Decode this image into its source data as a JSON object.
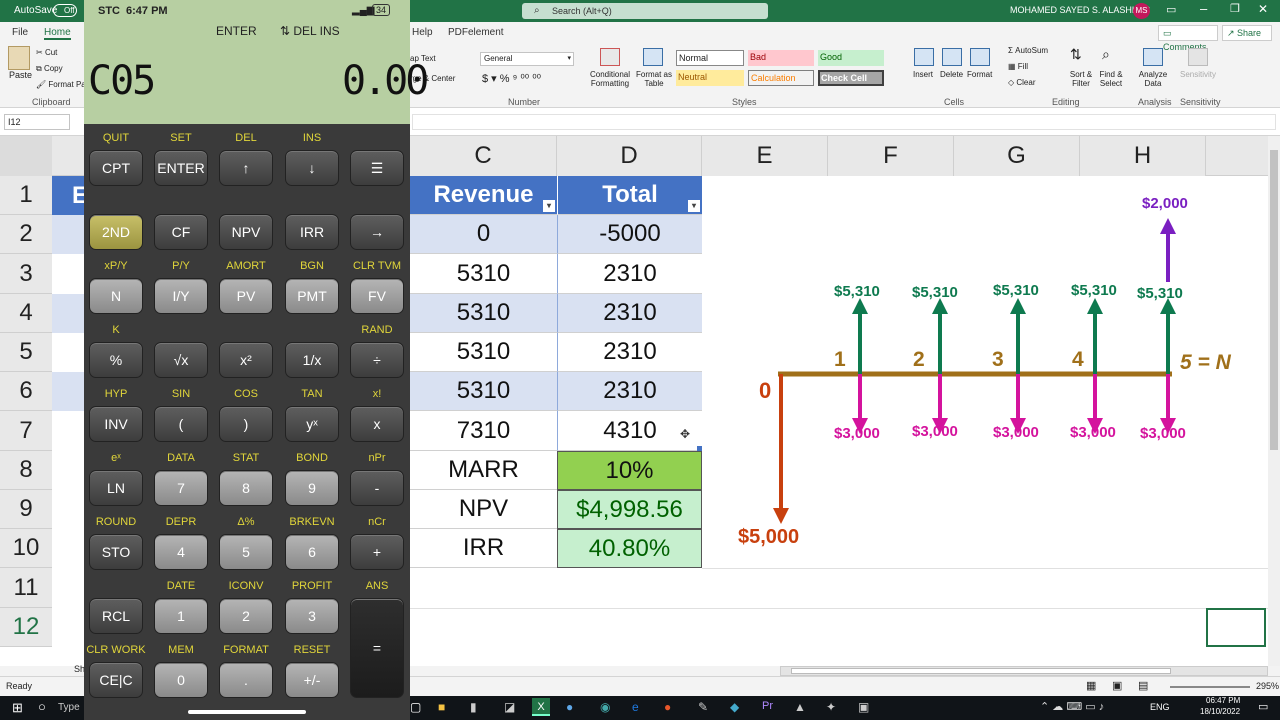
{
  "excel": {
    "titlebar": {
      "autosave": "AutoSave",
      "autosave_state": "Off",
      "search": "Search (Alt+Q)",
      "user": "MOHAMED SAYED S. ALASHHAB",
      "initials": "MS"
    },
    "ribbon_tabs": [
      "File",
      "Home",
      "Help",
      "PDFelement"
    ],
    "comments": "Comments",
    "share": "Share",
    "clipboard": {
      "paste": "Paste",
      "cut": "Cut",
      "copy": "Copy",
      "format_painter": "Format Pa",
      "group": "Clipboard"
    },
    "alignment": {
      "wrap_text": "ap Text",
      "merge": "rge & Center"
    },
    "number": {
      "format": "General",
      "group": "Number"
    },
    "styles": {
      "conditional": "Conditional Formatting",
      "format_table": "Format as Table",
      "normal": "Normal",
      "bad": "Bad",
      "good": "Good",
      "neutral": "Neutral",
      "calculation": "Calculation",
      "check_cell": "Check Cell",
      "group": "Styles"
    },
    "cells_group": {
      "insert": "Insert",
      "delete": "Delete",
      "format": "Format",
      "group": "Cells"
    },
    "editing": {
      "autosum": "AutoSum",
      "fill": "Fill",
      "clear": "Clear",
      "sort": "Sort & Filter",
      "find": "Find & Select",
      "group": "Editing"
    },
    "analysis": {
      "analyze": "Analyze Data",
      "group": "Analysis"
    },
    "sensitivity": {
      "label": "Sensitivity",
      "group": "Sensitivity"
    },
    "name_box": "I12",
    "columns": [
      "C",
      "D",
      "E",
      "F",
      "G",
      "H"
    ],
    "rows": [
      "1",
      "2",
      "3",
      "4",
      "5",
      "6",
      "7",
      "8",
      "9",
      "10",
      "11",
      "12"
    ],
    "col_b_header_fragment": "E",
    "table": {
      "header_c": "Revenue",
      "header_d": "Total",
      "c_values": [
        "0",
        "5310",
        "5310",
        "5310",
        "5310",
        "7310"
      ],
      "d_values": [
        "-5000",
        "2310",
        "2310",
        "2310",
        "2310",
        "4310"
      ],
      "marr_label": "MARR",
      "marr_value": "10%",
      "npv_label": "NPV",
      "npv_value": "$4,998.56",
      "irr_label": "IRR",
      "irr_value": "40.80%"
    },
    "cashflow": {
      "periods": [
        "0",
        "1",
        "2",
        "3",
        "4",
        "5 = N"
      ],
      "initial": "$5,000",
      "inflows": [
        "$5,310",
        "$5,310",
        "$5,310",
        "$5,310",
        "$5,310"
      ],
      "outflows": [
        "$3,000",
        "$3,000",
        "$3,000",
        "$3,000",
        "$3,000"
      ],
      "salvage": "$2,000",
      "colors": {
        "line": "#a0701a",
        "in": "#0e7a4f",
        "out": "#d4139d",
        "initial": "#c8400e",
        "salvage": "#7a1fc1"
      }
    },
    "status": {
      "ready": "Ready",
      "zoom": "295%",
      "sheet_fragment": "Sh"
    },
    "taskbar": {
      "search": "Type",
      "lang": "ENG",
      "time": "06:47 PM",
      "date": "18/10/2022"
    }
  },
  "calculator": {
    "status_bar": {
      "carrier": "STC",
      "time": "6:47 PM",
      "battery": "34"
    },
    "indicators": {
      "enter": "ENTER",
      "del_ins": "⇅ DEL INS"
    },
    "display_left": "C05",
    "display_right": "0.00",
    "rows": [
      [
        {
          "top": "QUIT",
          "label": "CPT"
        },
        {
          "top": "SET",
          "label": "ENTER"
        },
        {
          "top": "DEL",
          "label": "↑"
        },
        {
          "top": "INS",
          "label": "↓"
        },
        {
          "top": "",
          "label": "☰"
        }
      ],
      [
        {
          "top": "",
          "label": "2ND"
        },
        {
          "top": "",
          "label": "CF"
        },
        {
          "top": "",
          "label": "NPV"
        },
        {
          "top": "",
          "label": "IRR"
        },
        {
          "top": "",
          "label": "→"
        }
      ],
      [
        {
          "top": "xP/Y",
          "label": "N"
        },
        {
          "top": "P/Y",
          "label": "I/Y"
        },
        {
          "top": "AMORT",
          "label": "PV"
        },
        {
          "top": "BGN",
          "label": "PMT"
        },
        {
          "top": "CLR TVM",
          "label": "FV"
        }
      ],
      [
        {
          "top": "K",
          "label": "%"
        },
        {
          "top": "",
          "label": "√x"
        },
        {
          "top": "",
          "label": "x²"
        },
        {
          "top": "",
          "label": "1/x"
        },
        {
          "top": "RAND",
          "label": "÷"
        }
      ],
      [
        {
          "top": "HYP",
          "label": "INV"
        },
        {
          "top": "SIN",
          "label": "("
        },
        {
          "top": "COS",
          "label": ")"
        },
        {
          "top": "TAN",
          "label": "yˣ"
        },
        {
          "top": "x!",
          "label": "x"
        }
      ],
      [
        {
          "top": "eˣ",
          "label": "LN"
        },
        {
          "top": "DATA",
          "label": "7"
        },
        {
          "top": "STAT",
          "label": "8"
        },
        {
          "top": "BOND",
          "label": "9"
        },
        {
          "top": "nPr",
          "label": "-"
        }
      ],
      [
        {
          "top": "ROUND",
          "label": "STO"
        },
        {
          "top": "DEPR",
          "label": "4"
        },
        {
          "top": "Δ%",
          "label": "5"
        },
        {
          "top": "BRKEVN",
          "label": "6"
        },
        {
          "top": "nCr",
          "label": "+"
        }
      ],
      [
        {
          "top": "",
          "label": "RCL"
        },
        {
          "top": "DATE",
          "label": "1"
        },
        {
          "top": "ICONV",
          "label": "2"
        },
        {
          "top": "PROFIT",
          "label": "3"
        },
        {
          "top": "ANS",
          "label": "="
        }
      ],
      [
        {
          "top": "CLR WORK",
          "label": "CE|C"
        },
        {
          "top": "MEM",
          "label": "0"
        },
        {
          "top": "FORMAT",
          "label": "."
        },
        {
          "top": "RESET",
          "label": "+/-"
        }
      ]
    ]
  }
}
